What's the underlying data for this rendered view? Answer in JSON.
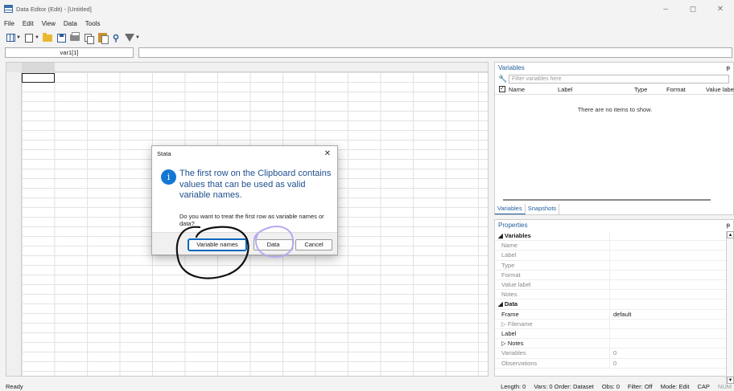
{
  "window": {
    "title": "Data Editor (Edit) - [Untitled]",
    "controls": [
      "–",
      "◻",
      "✕"
    ]
  },
  "menu": [
    "File",
    "Edit",
    "View",
    "Data",
    "Tools"
  ],
  "cell_ref": "var1[1]",
  "variables_pane": {
    "title": "Variables",
    "pin": "ᵽ",
    "filter_placeholder": "Filter variables here",
    "columns": [
      "Name",
      "Label",
      "Type",
      "Format",
      "Value label"
    ],
    "empty_text": "There are no items to show.",
    "tabs": [
      "Variables",
      "Snapshots"
    ]
  },
  "properties_pane": {
    "title": "Properties",
    "rows": [
      {
        "key": "◢ Variables",
        "value": "",
        "style": "section"
      },
      {
        "key": "Name",
        "value": "",
        "style": "grey"
      },
      {
        "key": "Label",
        "value": "",
        "style": "grey"
      },
      {
        "key": "Type",
        "value": "",
        "style": "grey"
      },
      {
        "key": "Format",
        "value": "",
        "style": "grey"
      },
      {
        "key": "Value label",
        "value": "",
        "style": "grey"
      },
      {
        "key": "Notes",
        "value": "",
        "style": "grey"
      },
      {
        "key": "◢ Data",
        "value": "",
        "style": "section"
      },
      {
        "key": "Frame",
        "value": "default",
        "style": "normal"
      },
      {
        "key": "▷ Filename",
        "value": "",
        "style": "grey"
      },
      {
        "key": "Label",
        "value": "",
        "style": "normal"
      },
      {
        "key": "▷ Notes",
        "value": "",
        "style": "normal"
      },
      {
        "key": "Variables",
        "value": "0",
        "style": "grey"
      },
      {
        "key": "Observations",
        "value": "0",
        "style": "grey"
      }
    ]
  },
  "status": {
    "left": "Ready",
    "items": [
      "Length: 0",
      "Vars: 0  Order: Dataset",
      "Obs: 0",
      "Filter: Off",
      "Mode: Edit",
      "CAP",
      "NUM"
    ]
  },
  "dialog": {
    "title": "Stata",
    "close": "✕",
    "icon_glyph": "i",
    "main_text": "The first row on the Clipboard contains values that can be used as valid variable names.",
    "sub_text": "Do you want to treat the first row as variable names or data?",
    "buttons": [
      "Variable names",
      "Data",
      "Cancel"
    ]
  },
  "colors": {
    "accent": "#1f5b9c",
    "info": "#1477d4",
    "annotation_black": "#111111",
    "annotation_purple": "#b9a8ef"
  },
  "icons": [
    "data-editor-icon",
    "grid-icon",
    "document-icon",
    "folder-icon",
    "save-icon",
    "print-icon",
    "copy-icon",
    "paste-icon",
    "find-icon",
    "filter-icon",
    "wrench-icon",
    "info-icon",
    "pin-icon",
    "close-icon"
  ]
}
